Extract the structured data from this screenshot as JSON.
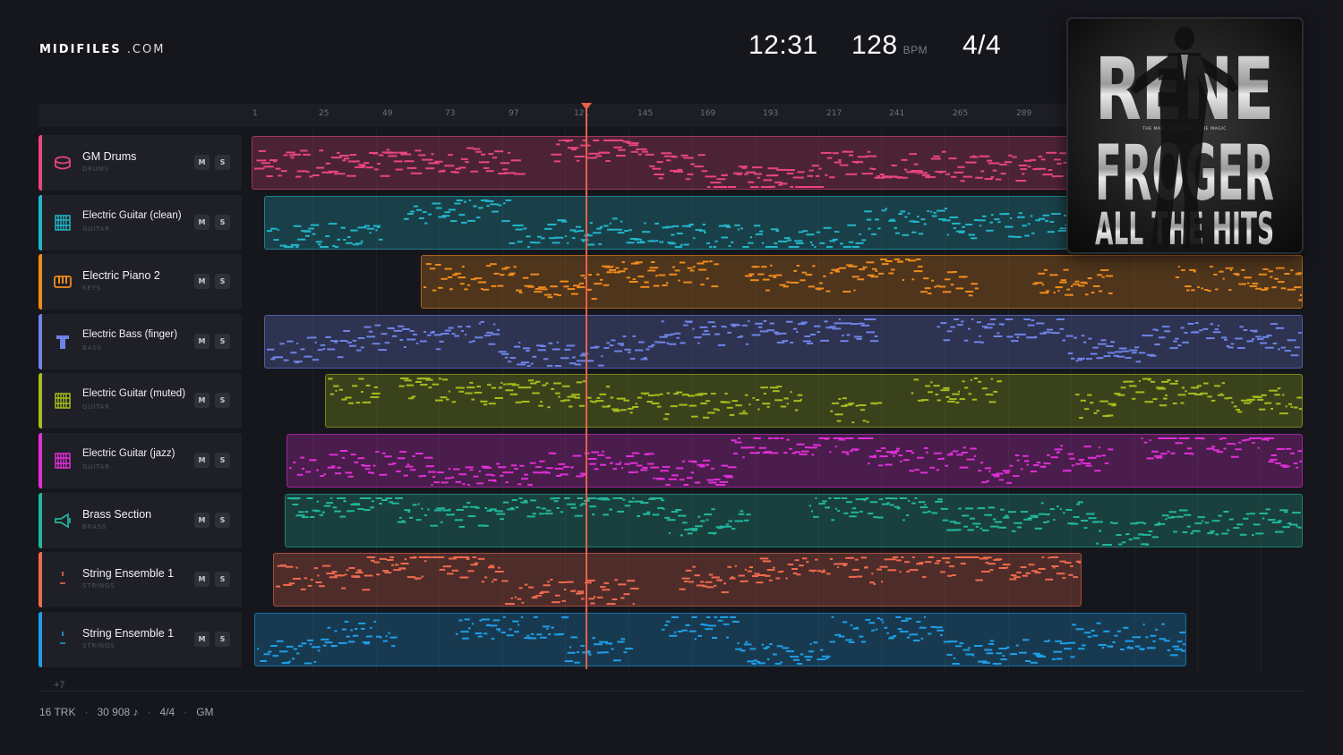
{
  "brand": {
    "name_bold": "MIDIFILES",
    "name_suffix": ".COM"
  },
  "header": {
    "time": "12:31",
    "tempo": "128",
    "tempo_unit": "BPM",
    "time_signature": "4/4"
  },
  "ruler": {
    "ticks": [
      "1",
      "25",
      "49",
      "73",
      "97",
      "121",
      "145",
      "169",
      "193",
      "217",
      "241",
      "265",
      "289"
    ]
  },
  "playhead": {
    "bar": 123
  },
  "album": {
    "artist_line1": "RENE",
    "artist_line2": "FROGER",
    "title": "ALL THE HITS",
    "tagline": "THE MAN. THE MUSIC. THE MAGIC"
  },
  "tracks": [
    {
      "name": "GM Drums",
      "category": "DRUMS",
      "color": "#e8467c",
      "icon": "drum-icon",
      "mute_label": "M",
      "solo_label": "S"
    },
    {
      "name": "Electric Guitar (clean)",
      "category": "GUITAR",
      "color": "#22b5c9",
      "icon": "guitar-icon",
      "mute_label": "M",
      "solo_label": "S"
    },
    {
      "name": "Electric Piano 2",
      "category": "KEYS",
      "color": "#f08a1c",
      "icon": "piano-icon",
      "mute_label": "M",
      "solo_label": "S"
    },
    {
      "name": "Electric Bass (finger)",
      "category": "BASS",
      "color": "#6f83e6",
      "icon": "bass-icon",
      "mute_label": "M",
      "solo_label": "S"
    },
    {
      "name": "Electric Guitar (muted)",
      "category": "GUITAR",
      "color": "#a4be1c",
      "icon": "guitar-icon",
      "mute_label": "M",
      "solo_label": "S"
    },
    {
      "name": "Electric Guitar (jazz)",
      "category": "GUITAR",
      "color": "#e02fd6",
      "icon": "guitar-icon",
      "mute_label": "M",
      "solo_label": "S"
    },
    {
      "name": "Brass Section",
      "category": "BRASS",
      "color": "#21b79c",
      "icon": "trumpet-icon",
      "mute_label": "M",
      "solo_label": "S"
    },
    {
      "name": "String Ensemble 1",
      "category": "STRINGS",
      "color": "#ef6a4e",
      "icon": "violin-icon",
      "mute_label": "M",
      "solo_label": "S"
    },
    {
      "name": "String Ensemble 1",
      "category": "STRINGS",
      "color": "#1e9ee8",
      "icon": "violin-icon",
      "mute_label": "M",
      "solo_label": "S"
    }
  ],
  "more_tracks": "+7",
  "footer": {
    "tracks": "16 TRK",
    "notes": "30 908 ♪",
    "time_signature": "4/4",
    "standard": "GM",
    "separator": "·"
  }
}
